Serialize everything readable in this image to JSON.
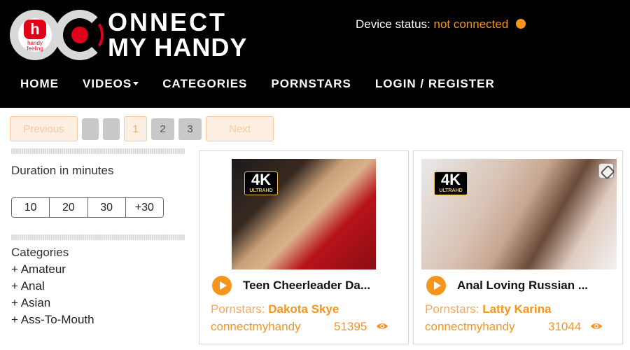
{
  "header": {
    "logo": {
      "text_line1": "ONNECT",
      "text_line2": "MY HANDY",
      "sub_text": "handy feeling"
    },
    "device_status": {
      "label": "Device status:",
      "value": "not connected",
      "status_color": "#f7941d"
    },
    "nav": [
      {
        "label": "HOME"
      },
      {
        "label": "VIDEOS",
        "has_dropdown": true
      },
      {
        "label": "CATEGORIES"
      },
      {
        "label": "PORNSTARS"
      },
      {
        "label": "LOGIN / REGISTER"
      }
    ]
  },
  "pagination": {
    "previous_label": "Previous",
    "next_label": "Next",
    "current_page": "1",
    "pages": [
      "2",
      "3"
    ]
  },
  "sidebar": {
    "duration": {
      "heading": "Duration in minutes",
      "options": [
        "10",
        "20",
        "30",
        "+30"
      ]
    },
    "categories": {
      "heading": "Categories",
      "items": [
        "+ Amateur",
        "+ Anal",
        "+ Asian",
        "+ Ass-To-Mouth"
      ]
    }
  },
  "videos": [
    {
      "title": "Teen Cheerleader Da...",
      "badge_main": "4K",
      "badge_sub": "ULTRAHD",
      "pornstars_label": "Pornstars:",
      "pornstar": "Dakota Skye",
      "channel": "connectmyhandy",
      "views": "51395"
    },
    {
      "title": "Anal Loving Russian ...",
      "badge_main": "4K",
      "badge_sub": "ULTRAHD",
      "pornstars_label": "Pornstars:",
      "pornstar": "Latty Karina",
      "channel": "connectmyhandy",
      "views": "31044",
      "handy_compatible_icon": true
    }
  ],
  "colors": {
    "accent": "#f7941d",
    "header_bg": "#000000",
    "logo_red": "#e0001a"
  }
}
